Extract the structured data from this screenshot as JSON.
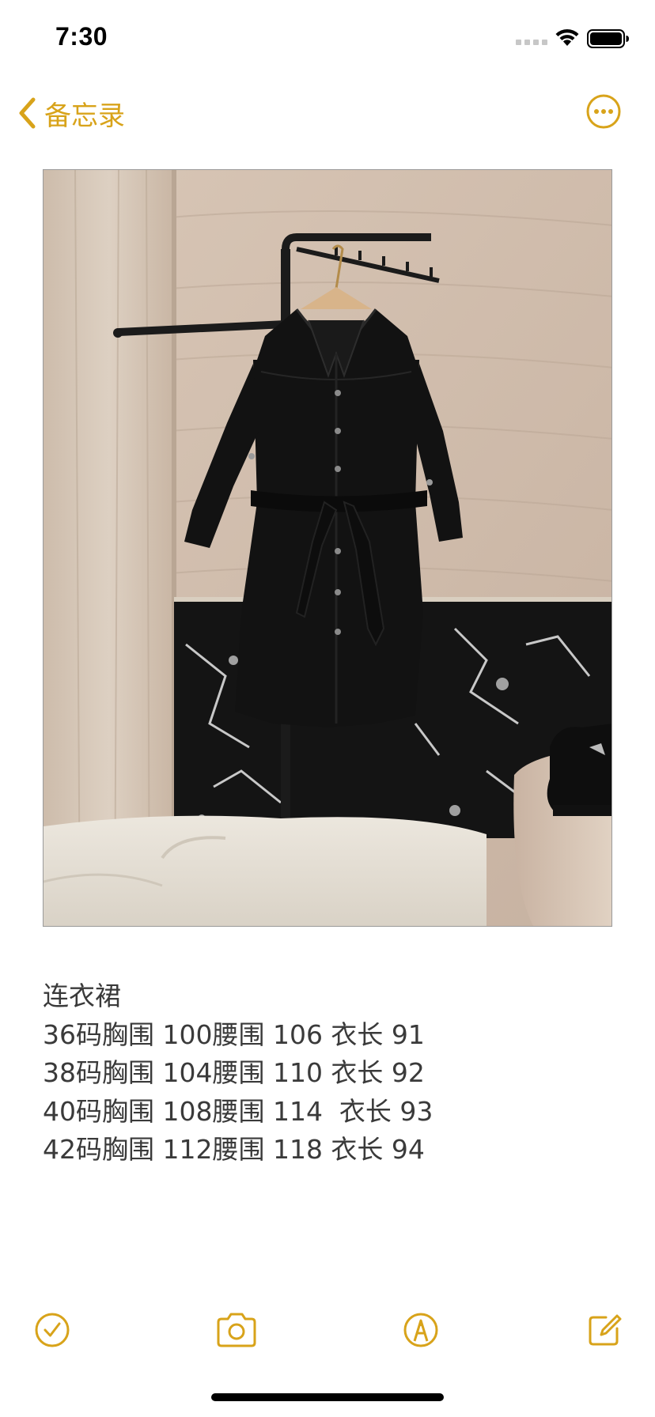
{
  "status_bar": {
    "time": "7:30",
    "icons": [
      "cellular-signal-icon",
      "wifi-icon",
      "battery-icon"
    ]
  },
  "nav": {
    "back_label": "备忘录",
    "back_icon": "chevron-left-icon",
    "more_icon": "ellipsis-circle-icon"
  },
  "photo": {
    "subject": "black belted shirt dress on hanger"
  },
  "note": {
    "lines": [
      "连衣裙",
      "36码胸围 100腰围 106 衣长 91",
      "38码胸围 104腰围 110 衣长 92",
      "40码胸围 108腰围 114  衣长 93",
      "42码胸围 112腰围 118 衣长 94"
    ]
  },
  "toolbar": {
    "icons": [
      "checklist-icon",
      "camera-icon",
      "markup-icon",
      "compose-icon"
    ]
  },
  "colors": {
    "accent": "#d8a31a",
    "text": "#3a3a3a",
    "background": "#ffffff"
  }
}
